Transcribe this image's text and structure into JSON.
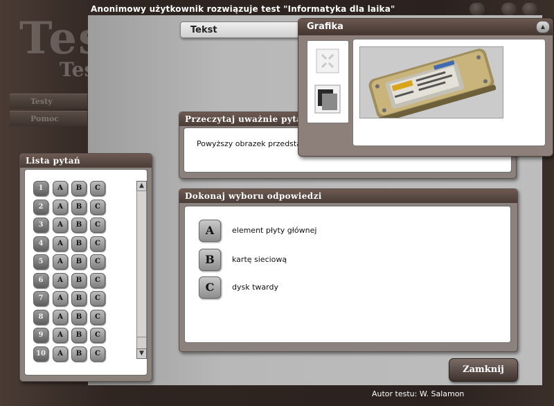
{
  "window": {
    "title": "Anonimowy użytkownik rozwiązuje test \"Informatyka dla laika\""
  },
  "logo": {
    "line1": "Testy",
    "line2": "Test"
  },
  "left_nav": [
    {
      "label": "Testy"
    },
    {
      "label": "Pomoc"
    }
  ],
  "text_tab": {
    "label": "Tekst"
  },
  "question_panel": {
    "title": "Przeczytaj uważnie pytanie",
    "text": "Powyższy obrazek przedstawia:"
  },
  "answers_panel": {
    "title": "Dokonaj wyboru odpowiedzi",
    "answers": [
      {
        "letter": "A",
        "text": "element płyty głównej"
      },
      {
        "letter": "B",
        "text": "kartę sieciową"
      },
      {
        "letter": "C",
        "text": "dysk twardy"
      }
    ]
  },
  "question_list": {
    "title": "Lista pytań",
    "rows": [
      {
        "num": "1"
      },
      {
        "num": "2"
      },
      {
        "num": "3"
      },
      {
        "num": "4"
      },
      {
        "num": "5"
      },
      {
        "num": "6"
      },
      {
        "num": "7"
      },
      {
        "num": "8"
      },
      {
        "num": "9"
      },
      {
        "num": "10"
      }
    ],
    "letters": [
      "A",
      "B",
      "C"
    ]
  },
  "graphics_window": {
    "title": "Grafika",
    "image_icon": "hard-disk-drive-photo",
    "side_icons": [
      "expand-icon",
      "layers-icon"
    ]
  },
  "close_button": {
    "label": "Zamknij"
  },
  "footer": {
    "author": "Autor testu: W. Salamon"
  }
}
